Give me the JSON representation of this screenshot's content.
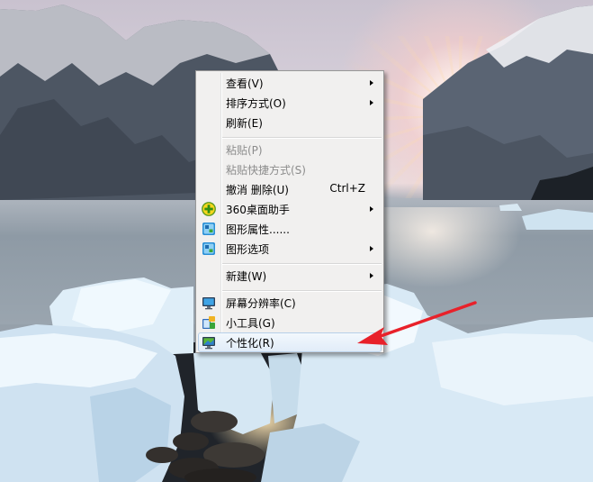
{
  "desktop": {
    "wallpaper": "glacier-sunrise"
  },
  "context_menu": {
    "items": [
      {
        "label": "查看(V)",
        "submenu": true
      },
      {
        "label": "排序方式(O)",
        "submenu": true
      },
      {
        "label": "刷新(E)"
      },
      {
        "label": "粘贴(P)",
        "disabled": true
      },
      {
        "label": "粘贴快捷方式(S)",
        "disabled": true
      },
      {
        "label": "撤消 删除(U)",
        "shortcut": "Ctrl+Z"
      },
      {
        "label": "360桌面助手",
        "submenu": true,
        "icon": "360-plus-icon"
      },
      {
        "label": "图形属性......",
        "icon": "graphics-icon"
      },
      {
        "label": "图形选项",
        "submenu": true,
        "icon": "graphics-icon"
      },
      {
        "label": "新建(W)",
        "submenu": true
      },
      {
        "label": "屏幕分辨率(C)",
        "icon": "monitor-icon"
      },
      {
        "label": "小工具(G)",
        "icon": "gadgets-icon"
      },
      {
        "label": "个性化(R)",
        "icon": "personalize-icon",
        "highlighted": true
      }
    ]
  },
  "colors": {
    "menu_bg": "#f1f0ef",
    "menu_border": "#979797",
    "disabled_text": "#8c8c8c",
    "annotation_arrow": "#e8212a"
  }
}
